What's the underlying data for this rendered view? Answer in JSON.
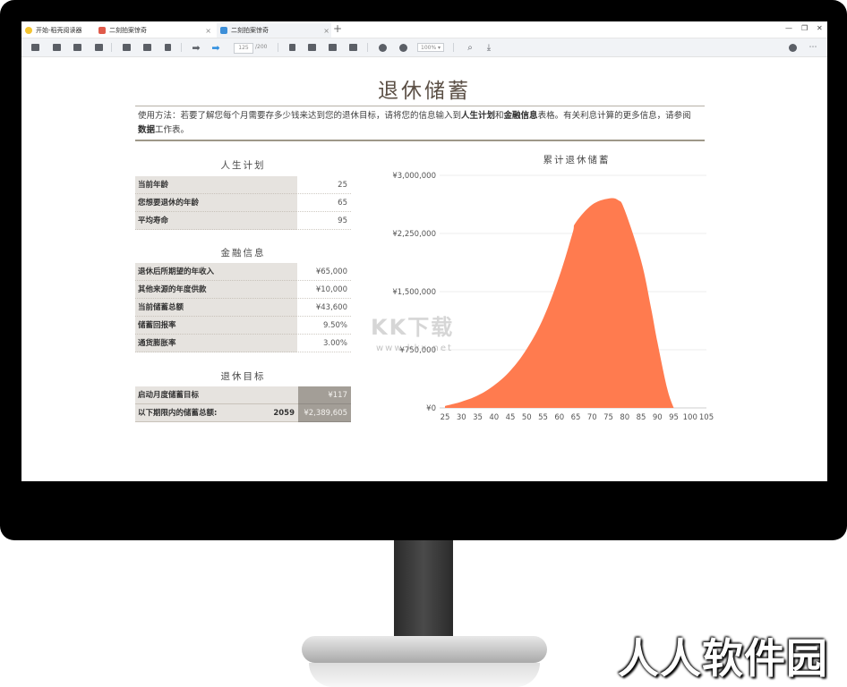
{
  "tabs": [
    {
      "label": "开始-稻壳阅读器",
      "color": "#f4c430",
      "active": false
    },
    {
      "label": "二刻拍案惊奇",
      "color": "#e05a4a",
      "active": false
    },
    {
      "label": "二刻拍案惊奇",
      "color": "#3d8fd8",
      "active": true
    }
  ],
  "new_tab": "+",
  "window_controls": {
    "minimize": "—",
    "restore": "❐",
    "close": "✕"
  },
  "toolbar": {
    "page_current": "125",
    "page_total": "/200",
    "zoom": "100% ▾"
  },
  "document": {
    "title": "退休储蓄",
    "instructions": {
      "p1": "使用方法：若要了解您每个月需要存多少钱来达到您的退休目标，请将您的信息输入到",
      "b1": "人生计划",
      "p2": "和",
      "b2": "金融信息",
      "p3": "表格。有关利息计算的更多信息，请参阅",
      "b3": "数据",
      "p4": "工作表。"
    },
    "life_plan": {
      "title": "人生计划",
      "rows": [
        {
          "label": "当前年龄",
          "value": "25"
        },
        {
          "label": "您想要退休的年龄",
          "value": "65"
        },
        {
          "label": "平均寿命",
          "value": "95"
        }
      ]
    },
    "financial": {
      "title": "金融信息",
      "rows": [
        {
          "label": "退休后所期望的年收入",
          "value": "¥65,000"
        },
        {
          "label": "其他来源的年度供款",
          "value": "¥10,000"
        },
        {
          "label": "当前储蓄总额",
          "value": "¥43,600"
        },
        {
          "label": "储蓄回报率",
          "value": "9.50%"
        },
        {
          "label": "通货膨胀率",
          "value": "3.00%"
        }
      ]
    },
    "goal": {
      "title": "退休目标",
      "rows": [
        {
          "label": "启动月度储蓄目标",
          "mid": "",
          "value": "¥117"
        },
        {
          "label": "以下期限内的储蓄总额:",
          "mid": "2059",
          "value": "¥2,389,605"
        }
      ]
    }
  },
  "watermark": {
    "main": "KK下载",
    "sub": "www.kkx.net"
  },
  "brand": "人人软件园",
  "chart_data": {
    "type": "area",
    "title": "累计退休储蓄",
    "color": "#ff7b4f",
    "x_ticks": [
      25,
      30,
      35,
      40,
      45,
      50,
      55,
      60,
      65,
      70,
      75,
      80,
      85,
      90,
      95,
      100,
      105
    ],
    "y_ticks": [
      0,
      750000,
      1500000,
      2250000,
      3000000
    ],
    "y_tick_labels": [
      "¥0",
      "¥750,000",
      "¥1,500,000",
      "¥2,250,000",
      "¥3,000,000"
    ],
    "xlim": [
      25,
      105
    ],
    "ylim": [
      0,
      3000000
    ],
    "grid": true,
    "x": [
      25,
      30,
      35,
      40,
      45,
      50,
      55,
      60,
      64,
      65,
      70,
      75,
      78,
      80,
      85,
      88,
      90,
      93,
      95
    ],
    "y": [
      25000,
      80000,
      160000,
      290000,
      480000,
      760000,
      1150000,
      1700000,
      2250000,
      2390000,
      2620000,
      2700000,
      2680000,
      2550000,
      1900000,
      1300000,
      850000,
      250000,
      0
    ]
  }
}
